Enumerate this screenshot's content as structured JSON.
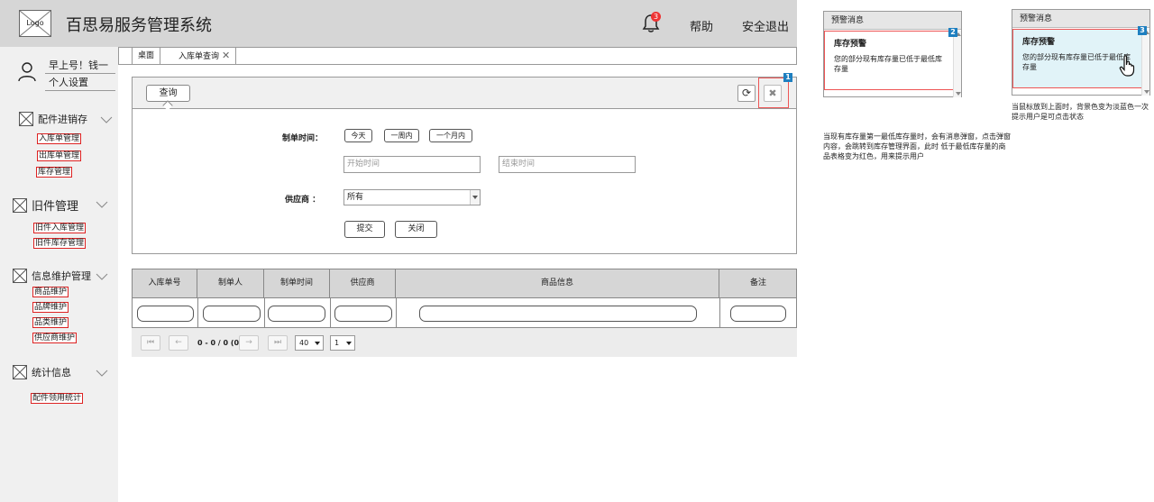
{
  "header": {
    "logo_text": "Logo",
    "title": "百思易服务管理系统",
    "notification_count": "3",
    "help_label": "帮助",
    "logout_label": "安全退出"
  },
  "user": {
    "greeting": "早上号！钱一",
    "settings_label": "个人设置"
  },
  "sidebar": {
    "groups": [
      {
        "label": "配件进销存",
        "items": [
          "入库单管理",
          "出库单管理",
          "库存管理"
        ]
      },
      {
        "label": "旧件管理",
        "items": [
          "旧件入库管理",
          "旧件库存管理"
        ]
      },
      {
        "label": "信息维护管理",
        "items": [
          "商品维护",
          "品牌维护",
          "品类维护",
          "供应商维护"
        ]
      },
      {
        "label": "统计信息",
        "items": [
          "配件领用统计"
        ]
      }
    ]
  },
  "tabs": [
    {
      "label": "桌面"
    },
    {
      "label": "入库单查询",
      "closable": true
    }
  ],
  "query": {
    "tab_label": "查询",
    "time_label": "制单时间：",
    "quick_buttons": [
      "今天",
      "一周内",
      "一个月内"
    ],
    "start_placeholder": "开始时间",
    "end_placeholder": "结束时间",
    "supplier_label": "供应商 ：",
    "supplier_value": "所有",
    "submit_label": "提交",
    "close_label": "关闭",
    "refresh_icon": "refresh-icon",
    "close_icon": "close-icon"
  },
  "table": {
    "columns": [
      "入库单号",
      "制单人",
      "制单时间",
      "供应商",
      "商品信息",
      "备注"
    ]
  },
  "pager": {
    "summary": "0 - 0 / 0 (0)",
    "page_size": "40",
    "page": "1"
  },
  "annotations": {
    "markers": [
      "1",
      "2",
      "3"
    ],
    "popup_title": "预警消息",
    "card_title": "库存预警",
    "card_body": "您的部分现有库存量已低于最低库存量",
    "note_left": "当现有库存量第一最低库存量时，会有消息弹窗，点击弹窗内容，会跳转到库存管理界面，此时 低于最低库存量的商品表格变为红色，用来提示用户",
    "note_right": "当鼠标放到上面时，背景色变为淡蓝色一次提示用户是可点击状态",
    "hover_bg": "#e1f3f8",
    "marker_color": "#1e7fc0",
    "highlight_color": "#e55555"
  }
}
